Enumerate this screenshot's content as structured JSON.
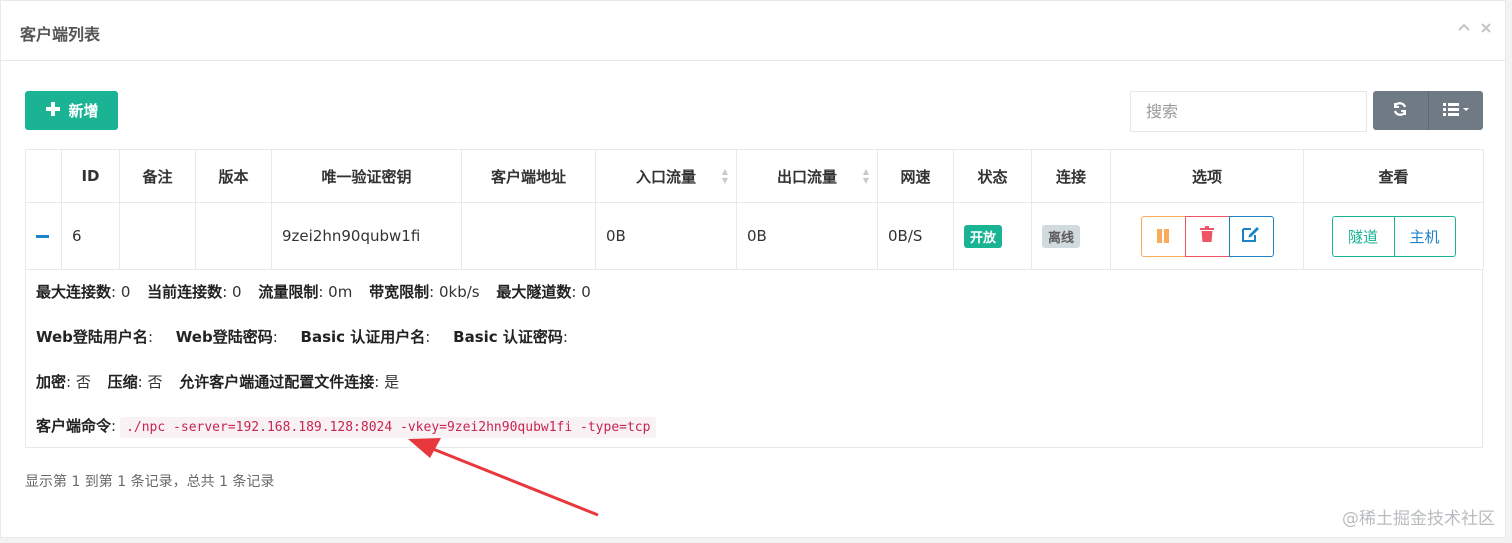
{
  "panel": {
    "title": "客户端列表",
    "collapse_icon": "chevron-up-icon",
    "close_icon": "close-icon"
  },
  "toolbar": {
    "add_label": "新增",
    "search_placeholder": "搜索",
    "refresh_icon": "refresh-icon",
    "columns_icon": "list-icon"
  },
  "table": {
    "headers": [
      "",
      "ID",
      "备注",
      "版本",
      "唯一验证密钥",
      "客户端地址",
      "入口流量",
      "出口流量",
      "网速",
      "状态",
      "连接",
      "选项",
      "查看"
    ],
    "row": {
      "id": "6",
      "remark": "",
      "version": "",
      "vkey": "9zei2hn90qubw1fi",
      "address": "",
      "inlet_flow": "0B",
      "export_flow": "0B",
      "rate": "0B/S",
      "status": "开放",
      "connect": "离线",
      "view_tunnel": "隧道",
      "view_host": "主机"
    }
  },
  "detail": {
    "max_conn_label": "最大连接数",
    "max_conn": ": 0",
    "now_conn_label": "当前连接数",
    "now_conn": ": 0",
    "flow_limit_label": "流量限制",
    "flow_limit": ": 0m",
    "rate_limit_label": "带宽限制",
    "rate_limit": ": 0kb/s",
    "max_tunnel_label": "最大隧道数",
    "max_tunnel": ": 0",
    "web_user_label": "Web登陆用户名",
    "web_pass_label": "Web登陆密码",
    "basic_user_label": "Basic 认证用户名",
    "basic_pass_label": "Basic 认证密码",
    "crypt_label": "加密",
    "crypt": ": 否",
    "compress_label": "压缩",
    "compress": ": 否",
    "config_conn_label": "允许客户端通过配置文件连接",
    "config_conn": ": 是",
    "cmd_label": "客户端命令",
    "cmd": "./npc -server=192.168.189.128:8024 -vkey=9zei2hn90qubw1fi -type=tcp"
  },
  "footer": {
    "info": "显示第 1 到第 1 条记录，总共 1 条记录"
  },
  "watermark": "@稀土掘金技术社区",
  "colors": {
    "primary": "#1ab394",
    "warning": "#f8ac59",
    "danger": "#ed5565",
    "info": "#1c84c6",
    "arrow": "#e8383d"
  }
}
